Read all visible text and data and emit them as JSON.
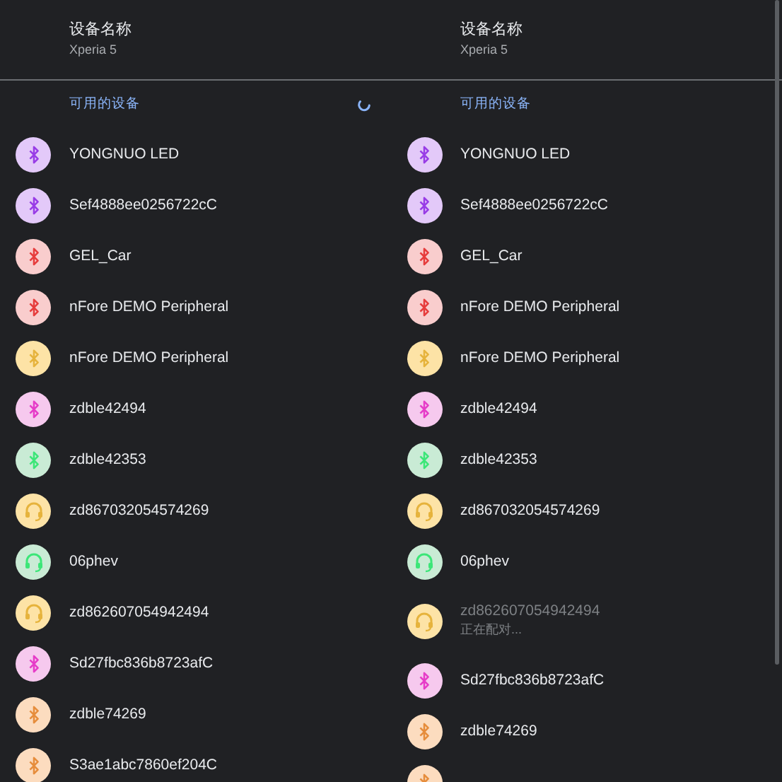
{
  "panels": [
    {
      "title": "设备名称",
      "subtitle": "Xperia 5",
      "section_title": "可用的设备",
      "loading": true,
      "devices": [
        {
          "name": "YONGNUO LED",
          "kind": "bluetooth",
          "color": "#e3c9f9",
          "disabled": false
        },
        {
          "name": "Sef4888ee0256722cC",
          "kind": "bluetooth",
          "color": "#e3c9f9",
          "disabled": false
        },
        {
          "name": "GEL_Car",
          "kind": "bluetooth",
          "color": "#f9cdcd",
          "disabled": false
        },
        {
          "name": "nFore DEMO Peripheral",
          "kind": "bluetooth",
          "color": "#f9cdcd",
          "disabled": false
        },
        {
          "name": "nFore DEMO Peripheral",
          "kind": "bluetooth",
          "color": "#fde3a6",
          "disabled": false
        },
        {
          "name": "zdble42494",
          "kind": "bluetooth",
          "color": "#f6c9ee",
          "disabled": false
        },
        {
          "name": "zdble42353",
          "kind": "bluetooth",
          "color": "#c9ebd5",
          "disabled": false
        },
        {
          "name": "zd867032054574269",
          "kind": "headset",
          "color": "#fde3a6",
          "disabled": false
        },
        {
          "name": "06phev",
          "kind": "headset",
          "color": "#c9ebd5",
          "disabled": false
        },
        {
          "name": "zd862607054942494",
          "kind": "headset",
          "color": "#fde3a6",
          "disabled": false
        },
        {
          "name": "Sd27fbc836b8723afC",
          "kind": "bluetooth",
          "color": "#f6c9ee",
          "disabled": false
        },
        {
          "name": "zdble74269",
          "kind": "bluetooth",
          "color": "#fcdcbf",
          "disabled": false
        },
        {
          "name": "S3ae1abc7860ef204C",
          "kind": "bluetooth",
          "color": "#fcdcbf",
          "disabled": false
        }
      ]
    },
    {
      "title": "设备名称",
      "subtitle": "Xperia 5",
      "section_title": "可用的设备",
      "loading": false,
      "devices": [
        {
          "name": "YONGNUO LED",
          "kind": "bluetooth",
          "color": "#e3c9f9",
          "disabled": false
        },
        {
          "name": "Sef4888ee0256722cC",
          "kind": "bluetooth",
          "color": "#e3c9f9",
          "disabled": false
        },
        {
          "name": "GEL_Car",
          "kind": "bluetooth",
          "color": "#f9cdcd",
          "disabled": false
        },
        {
          "name": "nFore DEMO Peripheral",
          "kind": "bluetooth",
          "color": "#f9cdcd",
          "disabled": false
        },
        {
          "name": "nFore DEMO Peripheral",
          "kind": "bluetooth",
          "color": "#fde3a6",
          "disabled": false
        },
        {
          "name": "zdble42494",
          "kind": "bluetooth",
          "color": "#f6c9ee",
          "disabled": false
        },
        {
          "name": "zdble42353",
          "kind": "bluetooth",
          "color": "#c9ebd5",
          "disabled": false
        },
        {
          "name": "zd867032054574269",
          "kind": "headset",
          "color": "#fde3a6",
          "disabled": false
        },
        {
          "name": "06phev",
          "kind": "headset",
          "color": "#c9ebd5",
          "disabled": false
        },
        {
          "name": "zd862607054942494",
          "kind": "headset",
          "color": "#fde3a6",
          "disabled": true,
          "status": "正在配对..."
        },
        {
          "name": "Sd27fbc836b8723afC",
          "kind": "bluetooth",
          "color": "#f6c9ee",
          "disabled": false
        },
        {
          "name": "zdble74269",
          "kind": "bluetooth",
          "color": "#fcdcbf",
          "disabled": false
        },
        {
          "kind": "bluetooth",
          "color": "#fcdcbf"
        }
      ]
    }
  ]
}
